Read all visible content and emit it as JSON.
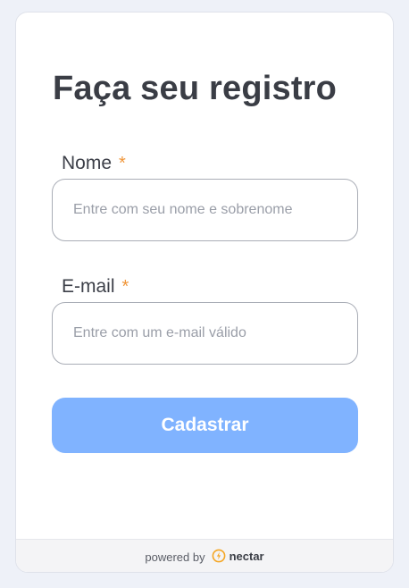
{
  "form": {
    "title": "Faça seu registro",
    "fields": [
      {
        "label": "Nome",
        "required_mark": "*",
        "value": "",
        "placeholder": "Entre com seu nome e sobrenome"
      },
      {
        "label": "E-mail",
        "required_mark": "*",
        "value": "",
        "placeholder": "Entre com um e-mail válido"
      }
    ],
    "submit_label": "Cadastrar"
  },
  "footer": {
    "powered_by": "powered by",
    "brand_name": "nectar",
    "brand_icon": "nectar-logo-icon"
  },
  "colors": {
    "page_background": "#eef1f8",
    "card_background": "#ffffff",
    "title_text": "#3a3d45",
    "required_mark": "#f0963a",
    "input_border": "#a9adb6",
    "button_background": "#80b3ff",
    "button_text": "#ffffff",
    "footer_background": "#f4f4f6",
    "brand_accent": "#f5a623"
  }
}
